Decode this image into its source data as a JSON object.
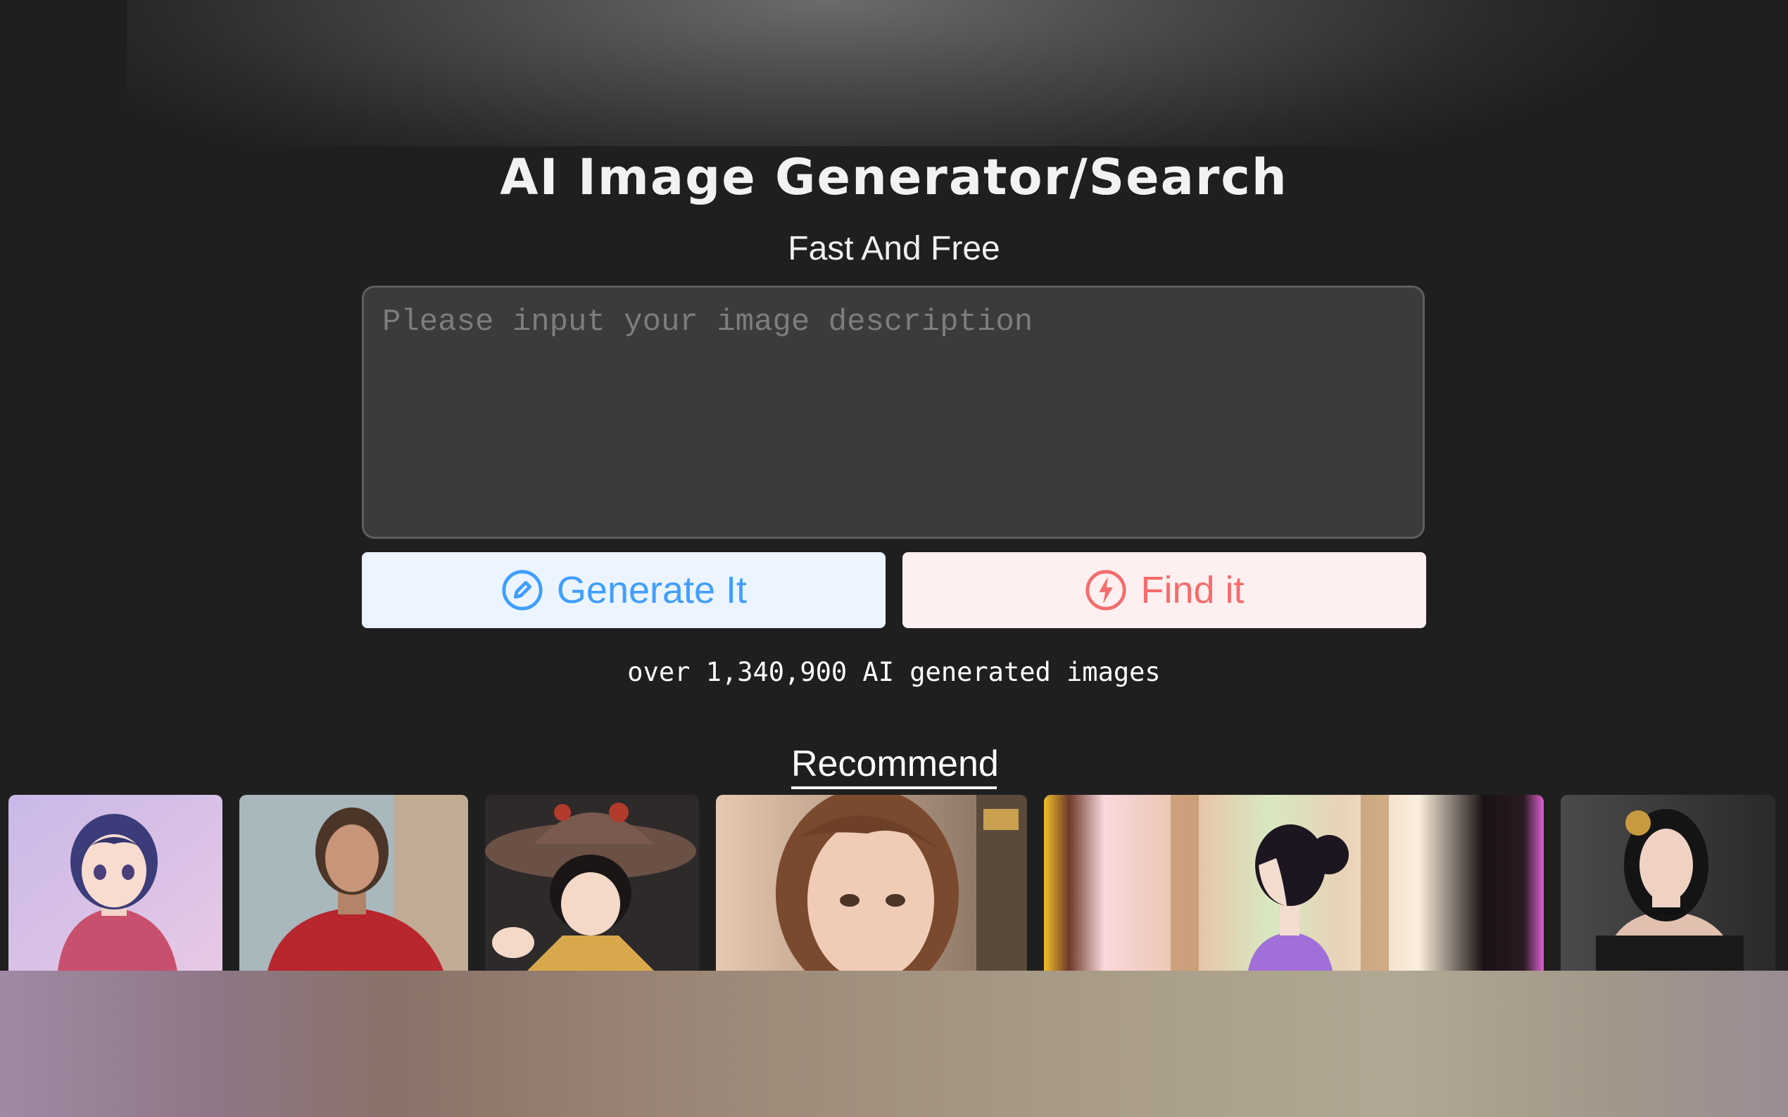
{
  "header": {
    "title": "AI Image Generator/Search",
    "subtitle": "Fast And Free"
  },
  "prompt": {
    "placeholder": "Please input your image description",
    "value": ""
  },
  "actions": {
    "generate_label": "Generate It",
    "generate_icon": "pencil-circle-icon",
    "find_label": "Find it",
    "find_icon": "lightning-circle-icon"
  },
  "stats": {
    "count_text": "over 1,340,900 AI generated images"
  },
  "recommend": {
    "heading": "Recommend",
    "items": [
      {
        "name": "anime-girl-pink-jacket"
      },
      {
        "name": "woman-red-armor"
      },
      {
        "name": "anime-witch-hat"
      },
      {
        "name": "realistic-girl-portrait"
      },
      {
        "name": "anime-girl-kimono-profile"
      },
      {
        "name": "woman-black-dress-gold-hairpin"
      }
    ]
  },
  "colors": {
    "background": "#1f1f1f",
    "generate_text": "#409eff",
    "generate_bg": "#ecf5ff",
    "find_text": "#f56c6c",
    "find_bg": "#fef0f0"
  }
}
